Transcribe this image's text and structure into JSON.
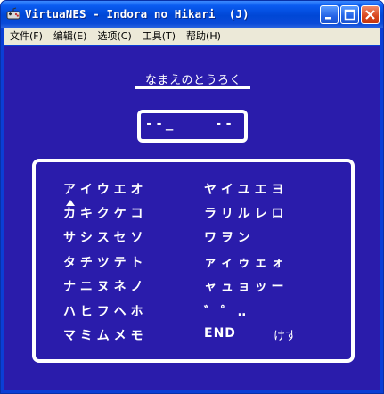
{
  "window": {
    "title": "VirtuaNES - Indora no Hikari  (J)",
    "colors": {
      "titlebar": "#0a4ad8",
      "screen_bg": "#2a1cab",
      "menu_bg": "#ece9d8"
    }
  },
  "menu": {
    "items": [
      "文件(F)",
      "编辑(E)",
      "选项(C)",
      "工具(T)",
      "帮助(H)"
    ]
  },
  "game": {
    "heading": "なまえのとうろく",
    "name_field": {
      "part1": "--_",
      "part2": "--"
    },
    "left_rows": [
      "ア イ ウ エ オ",
      "カ キ ク ケ コ",
      "サ シ ス セ ソ",
      "タ チ ツ テ ト",
      "ナ ニ ヌ ネ ノ",
      "ハ ヒ フ ヘ ホ",
      "マ ミ ム メ モ"
    ],
    "right_rows": [
      "ヤ イ ユ エ ヨ",
      "ラ リ ル レ ロ",
      "ワ ヲ ン",
      "ァ ィ ゥ ェ ォ",
      "ャ ュ ョ ッ ー",
      "゛ ゜ ‥"
    ],
    "end_label": "END",
    "delete_label": "けす"
  }
}
